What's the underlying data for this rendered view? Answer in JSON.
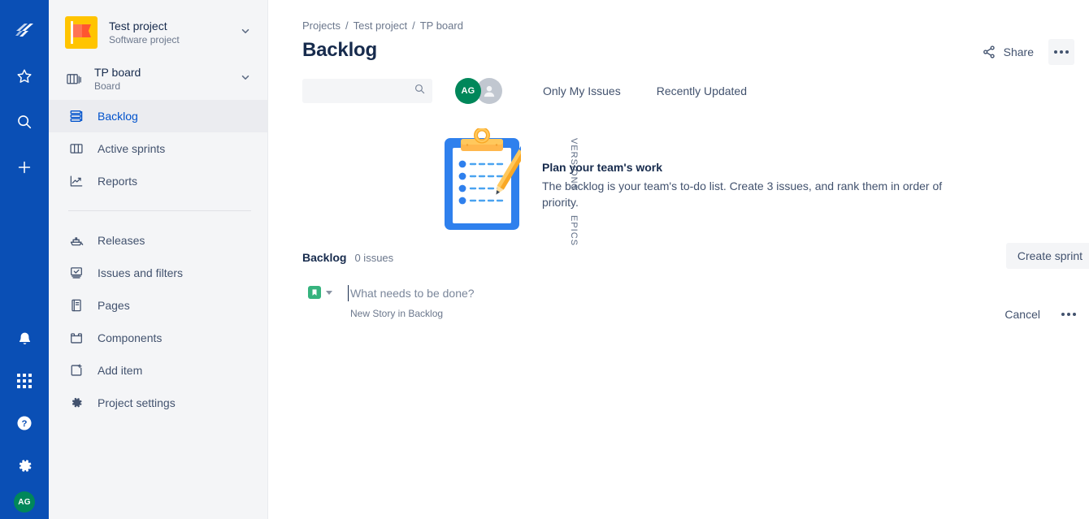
{
  "rail": {
    "logo_icon": "jira-logo-icon",
    "items": [
      {
        "name": "star-icon",
        "label": "Starred"
      },
      {
        "name": "search-icon",
        "label": "Search"
      },
      {
        "name": "plus-icon",
        "label": "Create"
      }
    ],
    "bottom_items": [
      {
        "name": "notifications-bell-icon",
        "label": "Notifications"
      },
      {
        "name": "app-switcher-grid-icon",
        "label": "Apps"
      },
      {
        "name": "help-question-icon",
        "label": "Help"
      },
      {
        "name": "settings-gear-icon",
        "label": "Settings"
      }
    ],
    "profile_initials": "AG",
    "profile_color": "#00875a"
  },
  "sidebar": {
    "project": {
      "name": "Test project",
      "type": "Software project",
      "avatar_icon": "project-flag-avatar",
      "chevron_icon": "chevron-down-icon"
    },
    "board": {
      "name": "TP board",
      "type": "Board",
      "icon": "board-stack-icon",
      "chevron_icon": "chevron-down-icon"
    },
    "nav_primary": [
      {
        "label": "Backlog",
        "icon": "backlog-icon",
        "active": true
      },
      {
        "label": "Active sprints",
        "icon": "columns-icon",
        "active": false
      },
      {
        "label": "Reports",
        "icon": "reports-chart-icon",
        "active": false
      }
    ],
    "nav_secondary": [
      {
        "label": "Releases",
        "icon": "releases-ship-icon"
      },
      {
        "label": "Issues and filters",
        "icon": "issues-filters-icon"
      },
      {
        "label": "Pages",
        "icon": "pages-doc-icon"
      },
      {
        "label": "Components",
        "icon": "components-box-icon"
      },
      {
        "label": "Add item",
        "icon": "add-item-icon"
      },
      {
        "label": "Project settings",
        "icon": "settings-gear-icon"
      }
    ]
  },
  "header": {
    "breadcrumb": [
      {
        "label": "Projects"
      },
      {
        "label": "Test project"
      },
      {
        "label": "TP board"
      }
    ],
    "breadcrumb_separator": "/",
    "title": "Backlog",
    "share_label": "Share",
    "share_icon": "share-node-icon",
    "more_icon": "more-horizontal-icon"
  },
  "filters": {
    "search_placeholder": "",
    "search_value": "",
    "search_icon": "search-icon",
    "avatars": [
      {
        "initials": "AG",
        "color": "#00875a",
        "name": "user-avatar-ag"
      },
      {
        "initials": "",
        "color": "#c1c7d0",
        "name": "avatar-placeholder"
      }
    ],
    "only_my_issues": "Only My Issues",
    "recently_updated": "Recently Updated"
  },
  "side_tabs": [
    {
      "label": "VERSIONS"
    },
    {
      "label": "EPICS"
    }
  ],
  "empty_state": {
    "illustration": "clipboard-checklist-illustration",
    "title": "Plan your team's work",
    "description": "The backlog is your team's to-do list. Create 3 issues, and rank them in order of priority."
  },
  "backlog": {
    "name": "Backlog",
    "issue_count_label": "0 issues",
    "create_sprint_label": "Create sprint",
    "new_issue": {
      "type_icon": "story-bookmark-icon",
      "type_color": "#36b37e",
      "caret_icon": "caret-down-icon",
      "placeholder": "What needs to be done?",
      "value": "",
      "hint": "New Story in Backlog",
      "cancel_label": "Cancel",
      "more_icon": "more-horizontal-icon"
    }
  },
  "colors": {
    "rail_bg": "#0a4fb5",
    "sidebar_bg": "#f4f5f7",
    "accent": "#0052cc",
    "text_primary": "#172b4d",
    "text_muted": "#6b778c"
  }
}
